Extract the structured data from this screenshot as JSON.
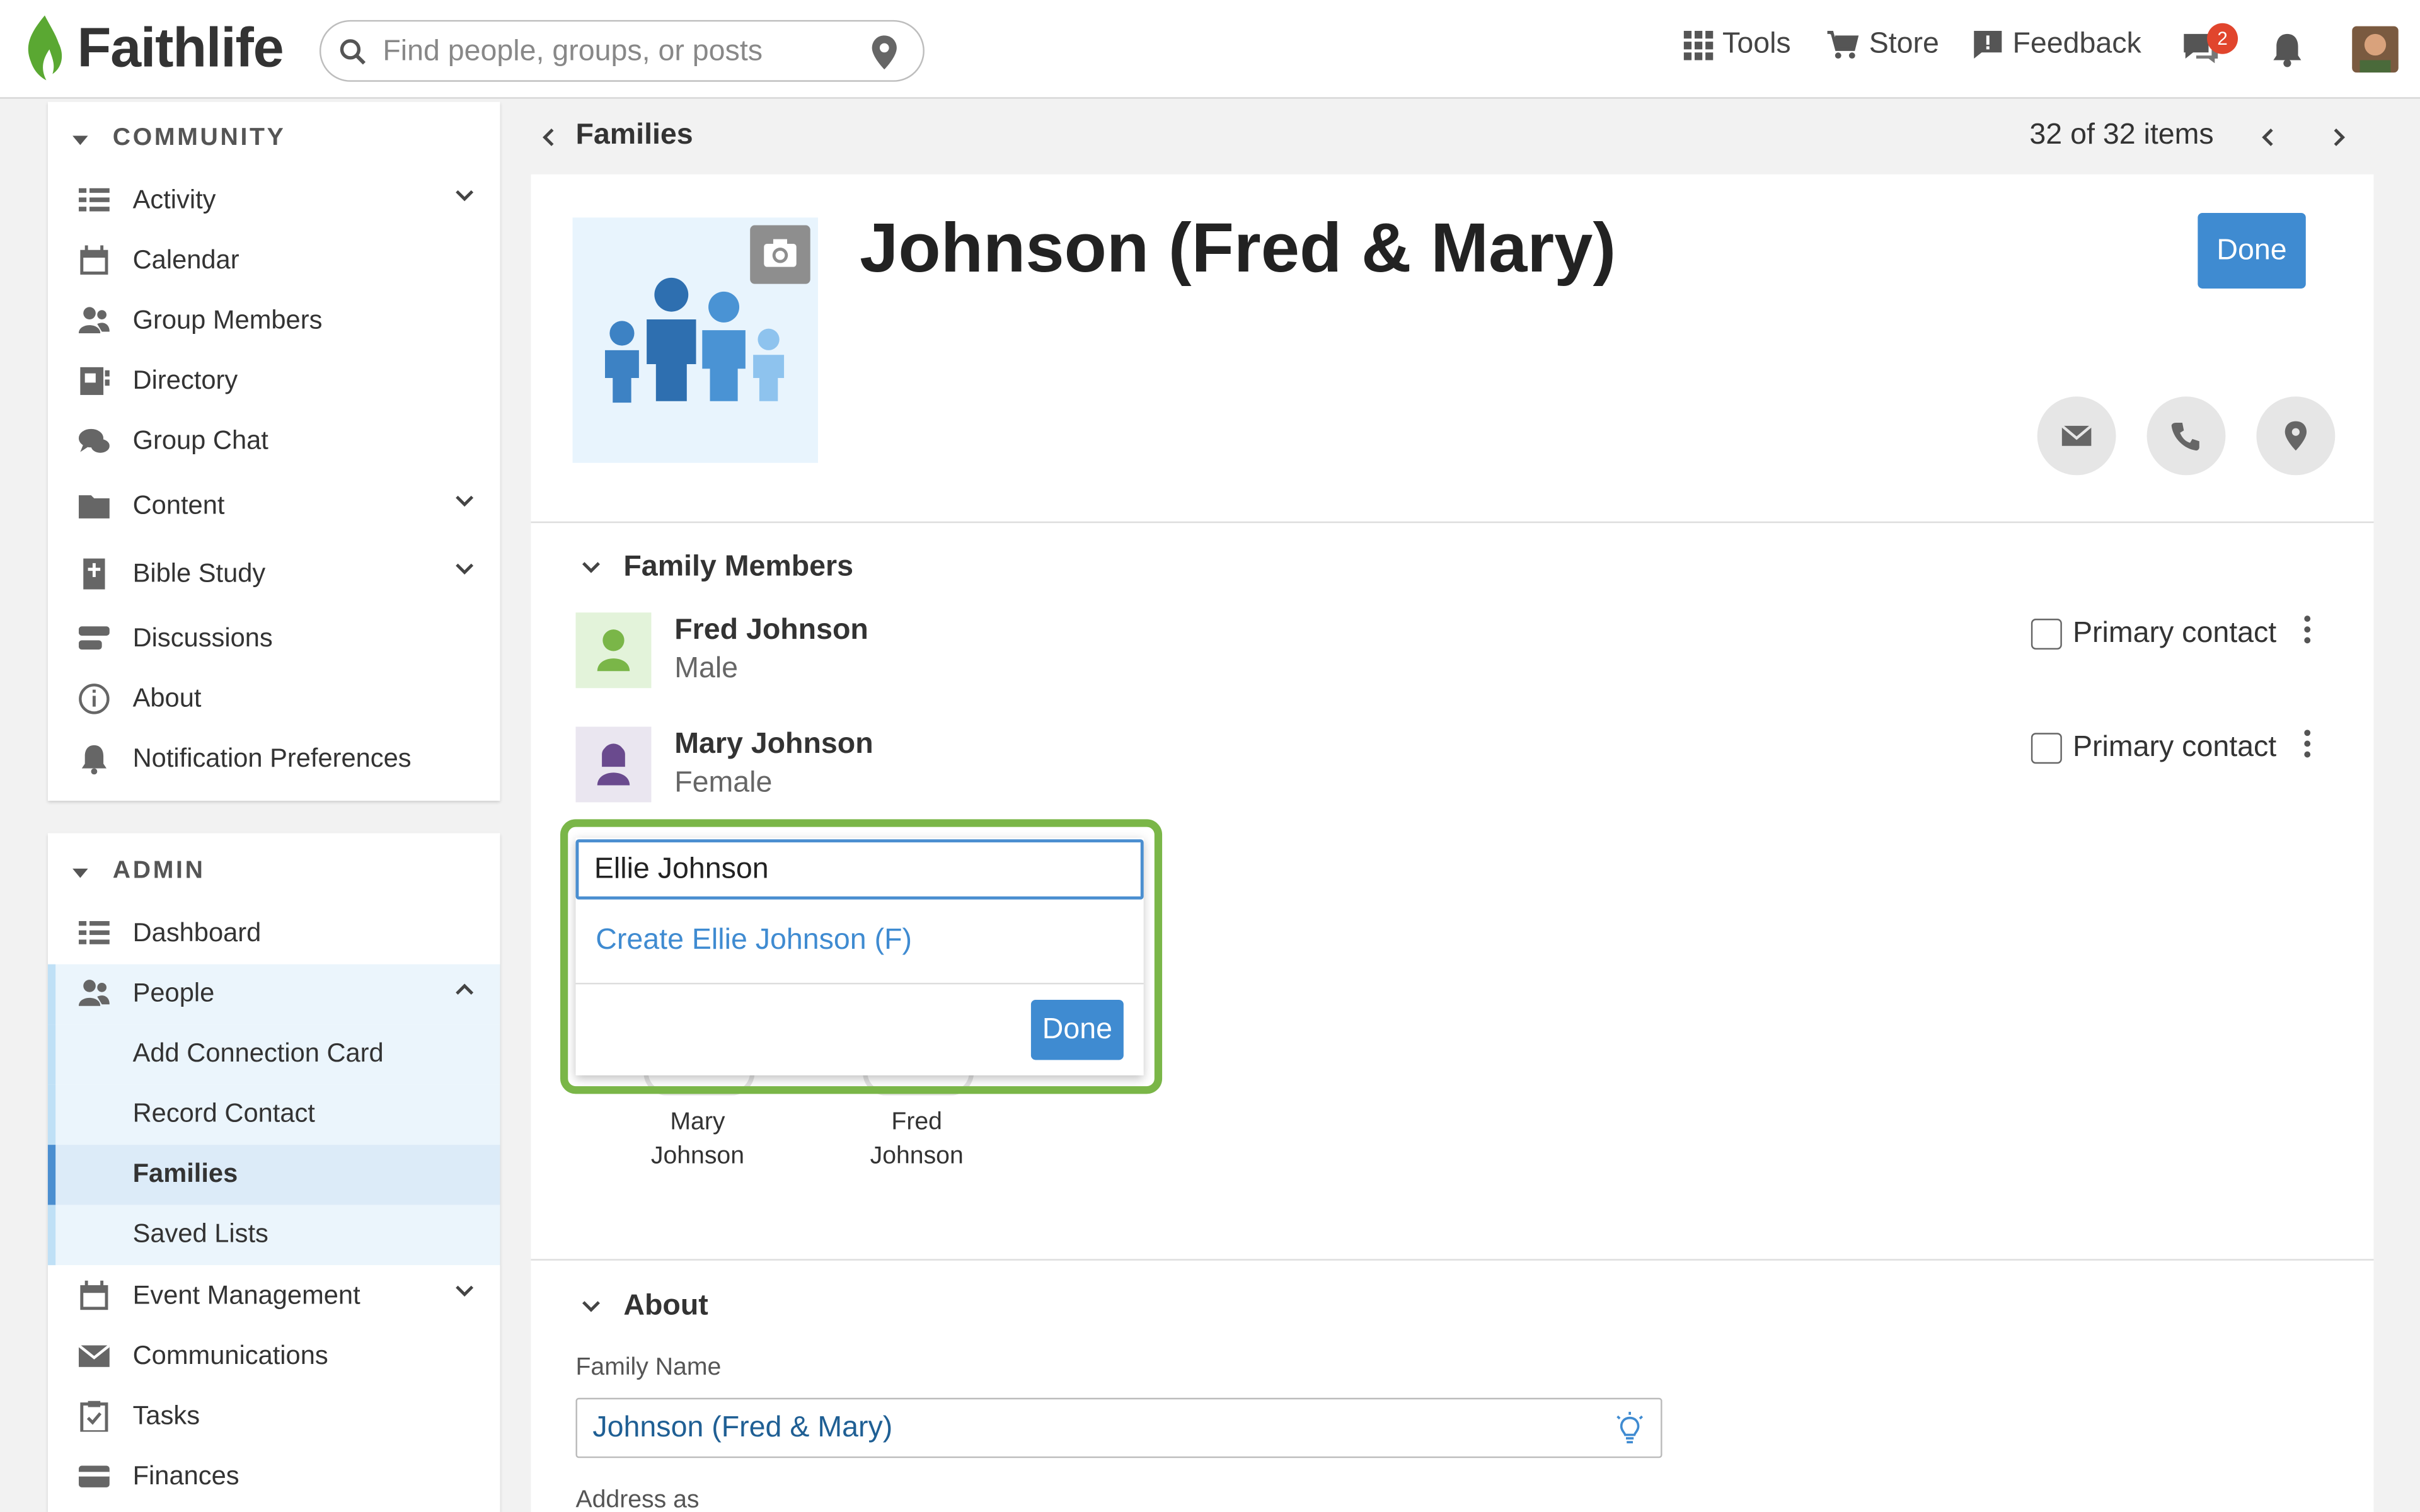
{
  "app": {
    "name": "Faithlife"
  },
  "search": {
    "placeholder": "Find people, groups, or posts"
  },
  "topnav": {
    "tools": "Tools",
    "store": "Store",
    "feedback": "Feedback",
    "messages_count": "2"
  },
  "sidebar": {
    "community_title": "COMMUNITY",
    "community_items": [
      {
        "label": "Activity"
      },
      {
        "label": "Calendar"
      },
      {
        "label": "Group Members"
      },
      {
        "label": "Directory"
      },
      {
        "label": "Group Chat"
      },
      {
        "label": "Content"
      },
      {
        "label": "Bible Study"
      },
      {
        "label": "Discussions"
      },
      {
        "label": "About"
      },
      {
        "label": "Notification Preferences"
      }
    ],
    "admin_title": "ADMIN",
    "admin_items": [
      {
        "label": "Dashboard"
      },
      {
        "label": "People"
      },
      {
        "label": "Event Management"
      },
      {
        "label": "Communications"
      },
      {
        "label": "Tasks"
      },
      {
        "label": "Finances"
      }
    ],
    "people_sub": [
      {
        "label": "Add Connection Card"
      },
      {
        "label": "Record Contact"
      },
      {
        "label": "Families"
      },
      {
        "label": "Saved Lists"
      }
    ]
  },
  "breadcrumb": {
    "label": "Families"
  },
  "pager": {
    "text": "32 of 32 items"
  },
  "family": {
    "title": "Johnson (Fred & Mary)",
    "done_label": "Done",
    "members_title": "Family Members",
    "members": [
      {
        "name": "Fred Johnson",
        "gender": "Male",
        "primary_label": "Primary contact"
      },
      {
        "name": "Mary Johnson",
        "gender": "Female",
        "primary_label": "Primary contact"
      }
    ],
    "tree": [
      {
        "first": "Mary",
        "last": "Johnson"
      },
      {
        "first": "Fred",
        "last": "Johnson"
      }
    ]
  },
  "popup": {
    "input_value": "Ellie Johnson",
    "create_link": "Create Ellie Johnson (F)",
    "done_label": "Done"
  },
  "about": {
    "title": "About",
    "family_name_label": "Family Name",
    "family_name_value": "Johnson (Fred & Mary)",
    "address_as_label": "Address as"
  },
  "colors": {
    "accent": "#3f8bd1",
    "highlight": "#7ab648",
    "brand_green": "#5aa832"
  }
}
